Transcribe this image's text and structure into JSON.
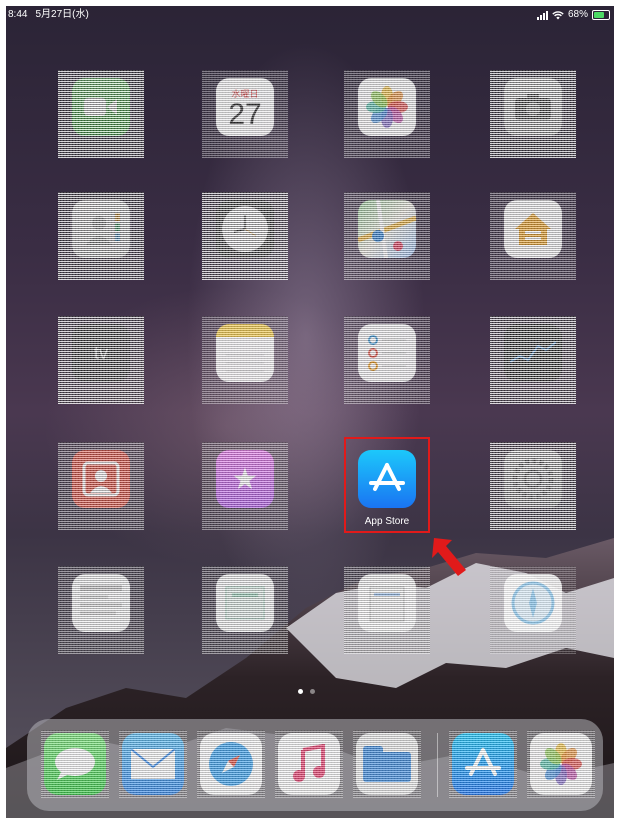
{
  "status_bar": {
    "time": "8:44",
    "date": "5月27日(水)",
    "battery_percent": "68%",
    "wifi_glyph": "📶",
    "colors": {
      "battery_fill": "#4cd964"
    }
  },
  "home_screen": {
    "calendar": {
      "weekday": "水曜日",
      "day": "27"
    },
    "tv_label": "tv",
    "highlighted_app": {
      "label": "App Store",
      "highlight_color": "#e11a1a"
    },
    "page_dots": {
      "count": 2,
      "active_index": 0
    }
  },
  "icons": {
    "apps": [
      "facetime-icon",
      "calendar-icon",
      "photos-icon",
      "camera-icon",
      "contacts-icon",
      "clock-icon",
      "maps-icon",
      "home-icon",
      "tv-icon",
      "notes-icon",
      "reminders-icon",
      "stocks-icon",
      "photo-booth-icon",
      "itunes-store-icon",
      "app-store-icon",
      "settings-icon",
      "news-icon",
      "books-icon",
      "files-icon",
      "safari-icon"
    ],
    "dock": [
      "messages-icon",
      "mail-icon",
      "safari-icon",
      "music-icon",
      "files-icon",
      "app-store-recent-icon",
      "photos-recent-icon"
    ]
  }
}
